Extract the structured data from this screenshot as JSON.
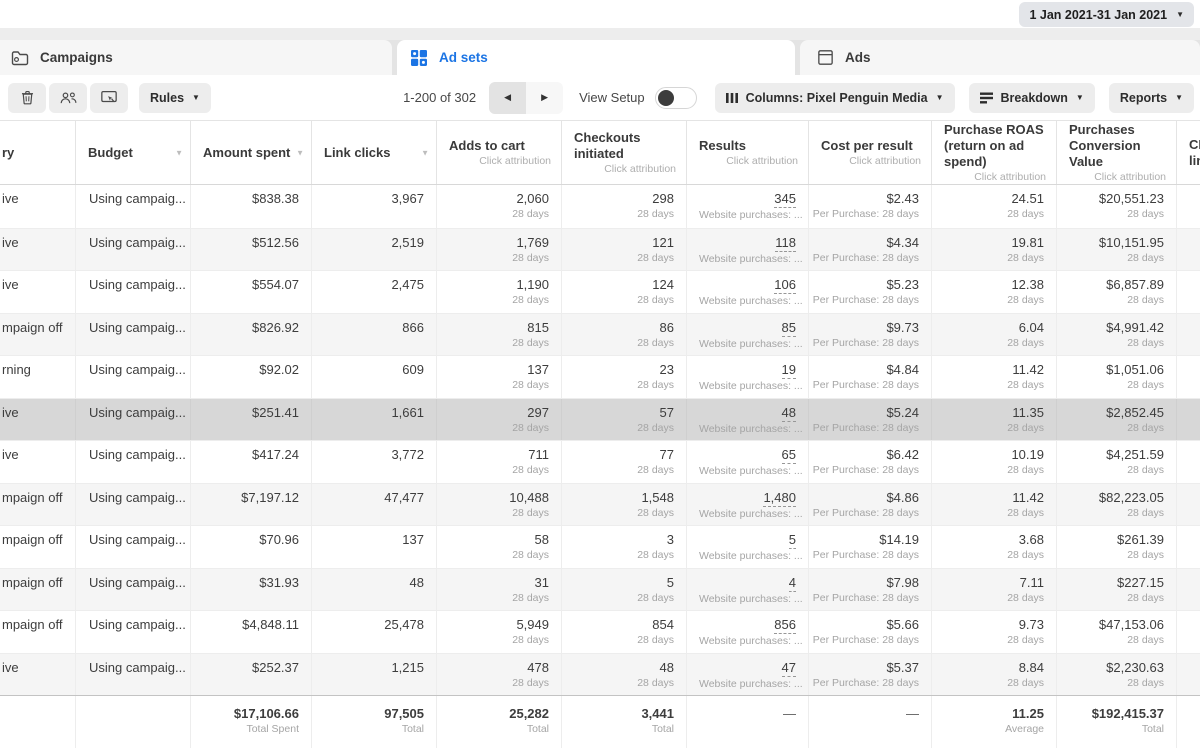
{
  "topbar": {
    "date_range": "1 Jan 2021-31 Jan 2021"
  },
  "glyphs": {
    "caret": "▼",
    "sort": "▼",
    "prev": "◀",
    "next": "▶"
  },
  "tabs": [
    {
      "label": "Campaigns",
      "icon": "folder-icon",
      "active": false
    },
    {
      "label": "Ad sets",
      "icon": "grid-icon",
      "active": true
    },
    {
      "label": "Ads",
      "icon": "frame-icon",
      "active": false
    }
  ],
  "toolbar": {
    "rules_label": "Rules",
    "pagination": "1-200 of 302",
    "view_setup_label": "View Setup",
    "columns_label": "Columns: Pixel Penguin Media",
    "breakdown_label": "Breakdown",
    "reports_label": "Reports"
  },
  "table": {
    "columns": [
      {
        "label": "ry"
      },
      {
        "label": "Budget",
        "sortable": true
      },
      {
        "label": "Amount spent",
        "sortable": true
      },
      {
        "label": "Link clicks",
        "sortable": true
      },
      {
        "label": "Adds to cart",
        "sub": "Click attribution"
      },
      {
        "label": "Checkouts initiated",
        "sub": "Click attribution"
      },
      {
        "label": "Results",
        "sub": "Click attribution"
      },
      {
        "label": "Cost per result",
        "sub": "Click attribution"
      },
      {
        "label": "Purchase ROAS (return on ad spend)",
        "sub": "Click attribution"
      },
      {
        "label": "Purchases Conversion Value",
        "sub": "Click attribution"
      },
      {
        "label": "CP",
        "sub": "lin"
      }
    ],
    "sublabels": {
      "days": "28 days",
      "website_purchases": "Website purchases: ...",
      "per_purchase": "Per Purchase: 28 days"
    },
    "rows": [
      {
        "delivery": "ive",
        "budget": "Using campaig...",
        "amount_spent": "$838.38",
        "link_clicks": "3,967",
        "adds_to_cart": "2,060",
        "checkouts": "298",
        "results": "345",
        "cost_per_result": "$2.43",
        "roas": "24.51",
        "pcv": "$20,551.23"
      },
      {
        "delivery": "ive",
        "budget": "Using campaig...",
        "amount_spent": "$512.56",
        "link_clicks": "2,519",
        "adds_to_cart": "1,769",
        "checkouts": "121",
        "results": "118",
        "cost_per_result": "$4.34",
        "roas": "19.81",
        "pcv": "$10,151.95"
      },
      {
        "delivery": "ive",
        "budget": "Using campaig...",
        "amount_spent": "$554.07",
        "link_clicks": "2,475",
        "adds_to_cart": "1,190",
        "checkouts": "124",
        "results": "106",
        "cost_per_result": "$5.23",
        "roas": "12.38",
        "pcv": "$6,857.89"
      },
      {
        "delivery": "mpaign off",
        "budget": "Using campaig...",
        "amount_spent": "$826.92",
        "link_clicks": "866",
        "adds_to_cart": "815",
        "checkouts": "86",
        "results": "85",
        "cost_per_result": "$9.73",
        "roas": "6.04",
        "pcv": "$4,991.42"
      },
      {
        "delivery": "rning",
        "budget": "Using campaig...",
        "amount_spent": "$92.02",
        "link_clicks": "609",
        "adds_to_cart": "137",
        "checkouts": "23",
        "results": "19",
        "cost_per_result": "$4.84",
        "roas": "11.42",
        "pcv": "$1,051.06"
      },
      {
        "delivery": "ive",
        "budget": "Using campaig...",
        "amount_spent": "$251.41",
        "link_clicks": "1,661",
        "adds_to_cart": "297",
        "checkouts": "57",
        "results": "48",
        "cost_per_result": "$5.24",
        "roas": "11.35",
        "pcv": "$2,852.45",
        "selected": true
      },
      {
        "delivery": "ive",
        "budget": "Using campaig...",
        "amount_spent": "$417.24",
        "link_clicks": "3,772",
        "adds_to_cart": "711",
        "checkouts": "77",
        "results": "65",
        "cost_per_result": "$6.42",
        "roas": "10.19",
        "pcv": "$4,251.59"
      },
      {
        "delivery": "mpaign off",
        "budget": "Using campaig...",
        "amount_spent": "$7,197.12",
        "link_clicks": "47,477",
        "adds_to_cart": "10,488",
        "checkouts": "1,548",
        "results": "1,480",
        "cost_per_result": "$4.86",
        "roas": "11.42",
        "pcv": "$82,223.05"
      },
      {
        "delivery": "mpaign off",
        "budget": "Using campaig...",
        "amount_spent": "$70.96",
        "link_clicks": "137",
        "adds_to_cart": "58",
        "checkouts": "3",
        "results": "5",
        "cost_per_result": "$14.19",
        "roas": "3.68",
        "pcv": "$261.39"
      },
      {
        "delivery": "mpaign off",
        "budget": "Using campaig...",
        "amount_spent": "$31.93",
        "link_clicks": "48",
        "adds_to_cart": "31",
        "checkouts": "5",
        "results": "4",
        "cost_per_result": "$7.98",
        "roas": "7.11",
        "pcv": "$227.15"
      },
      {
        "delivery": "mpaign off",
        "budget": "Using campaig...",
        "amount_spent": "$4,848.11",
        "link_clicks": "25,478",
        "adds_to_cart": "5,949",
        "checkouts": "854",
        "results": "856",
        "cost_per_result": "$5.66",
        "roas": "9.73",
        "pcv": "$47,153.06"
      },
      {
        "delivery": "ive",
        "budget": "Using campaig...",
        "amount_spent": "$252.37",
        "link_clicks": "1,215",
        "adds_to_cart": "478",
        "checkouts": "48",
        "results": "47",
        "cost_per_result": "$5.37",
        "roas": "8.84",
        "pcv": "$2,230.63"
      }
    ],
    "totals": {
      "amount_spent": "$17,106.66",
      "amount_sub": "Total Spent",
      "link_clicks": "97,505",
      "link_sub": "Total",
      "adds_to_cart": "25,282",
      "adds_sub": "Total",
      "checkouts": "3,441",
      "checkouts_sub": "Total",
      "results": "—",
      "cost_per_result": "—",
      "roas": "11.25",
      "roas_sub": "Average",
      "pcv": "$192,415.37",
      "pcv_sub": "Total"
    }
  }
}
